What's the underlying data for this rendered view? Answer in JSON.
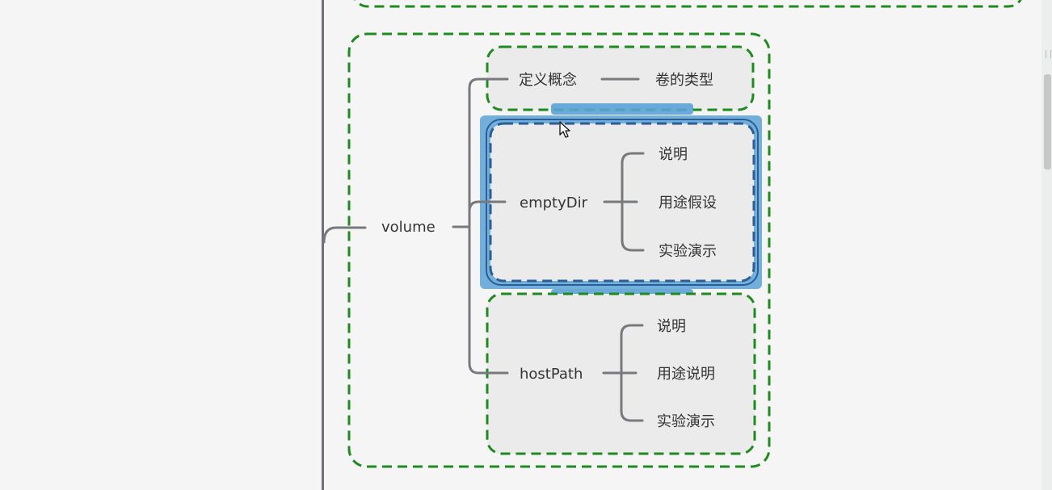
{
  "colors": {
    "group_border": "#1f8a1f",
    "connector": "#77797c",
    "selection": "#5aa2d6",
    "selection_dark": "#2b5e96",
    "text": "#333333",
    "group_fill": "#eaebea"
  },
  "mindmap": {
    "root": "volume",
    "branches": [
      {
        "label": "定义概念",
        "children": [
          "卷的类型"
        ]
      },
      {
        "label": "emptyDir",
        "children": [
          "说明",
          "用途假设",
          "实验演示"
        ],
        "selected": true
      },
      {
        "label": "hostPath",
        "children": [
          "说明",
          "用途说明",
          "实验演示"
        ]
      }
    ]
  },
  "icons": {
    "cursor": "mouse-pointer-icon"
  }
}
